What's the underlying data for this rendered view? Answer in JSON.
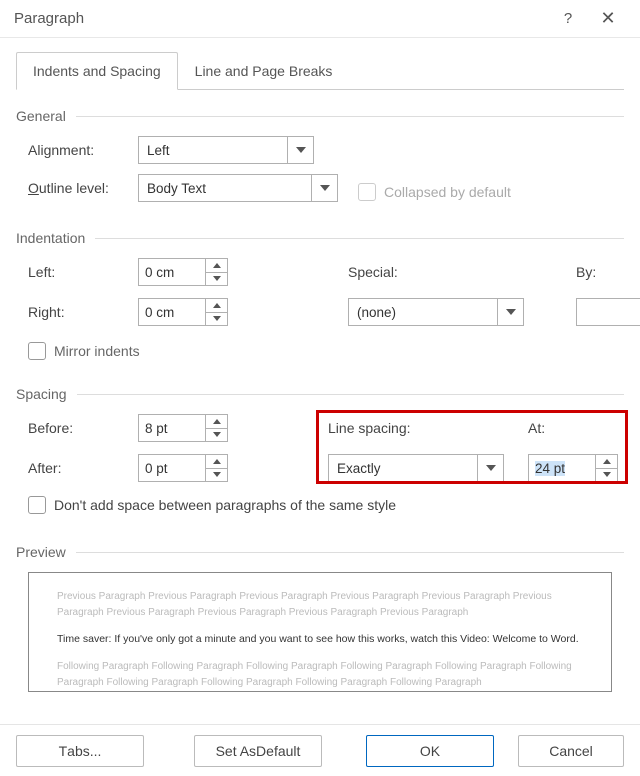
{
  "title": "Paragraph",
  "tabs": {
    "indents": "Indents and Spacing",
    "linepage": "Line and Page Breaks"
  },
  "general": {
    "header": "General",
    "alignment_label": "Alignment:",
    "alignment_value": "Left",
    "outline_label_pre": "O",
    "outline_label_post": "utline level:",
    "outline_value": "Body Text",
    "collapsed": "Collapsed by default"
  },
  "indentation": {
    "header": "Indentation",
    "left_label_pre": "L",
    "left_label_post": "eft:",
    "left_value": "0 cm",
    "right_label_pre": "R",
    "right_label_post": "ight:",
    "right_value": "0 cm",
    "special_label_pre": "S",
    "special_label_post": "pecial:",
    "special_value": "(none)",
    "by_label_pre": "B",
    "by_label_post": "y:",
    "mirror": "Mirror indents"
  },
  "spacing": {
    "header": "Spacing",
    "before_label_pre": "B",
    "before_label_post": "efore:",
    "before_value": "8 pt",
    "after_label_pre": "A",
    "after_label_post": "fter:",
    "after_value": "0 pt",
    "line_label_pre": "L",
    "line_label_post": "ine spacing:",
    "line_value": "Exactly",
    "at_label_pre": "A",
    "at_label_post": "t:",
    "at_value": "24 pt",
    "nospace": "Don't add space between paragraphs of the same style"
  },
  "preview": {
    "header": "Preview",
    "grey1": "Previous Paragraph Previous Paragraph Previous Paragraph Previous Paragraph Previous Paragraph Previous Paragraph Previous Paragraph Previous Paragraph Previous Paragraph Previous Paragraph",
    "black": "Time saver: If you've only got a minute and you want to see how this works, watch this Video: Welcome to Word.",
    "grey2": "Following Paragraph Following Paragraph Following Paragraph Following Paragraph Following Paragraph Following Paragraph Following Paragraph Following Paragraph Following Paragraph Following Paragraph"
  },
  "footer": {
    "tabs": "Tabs...",
    "default": "Set As Default",
    "ok": "OK",
    "cancel": "Cancel"
  }
}
